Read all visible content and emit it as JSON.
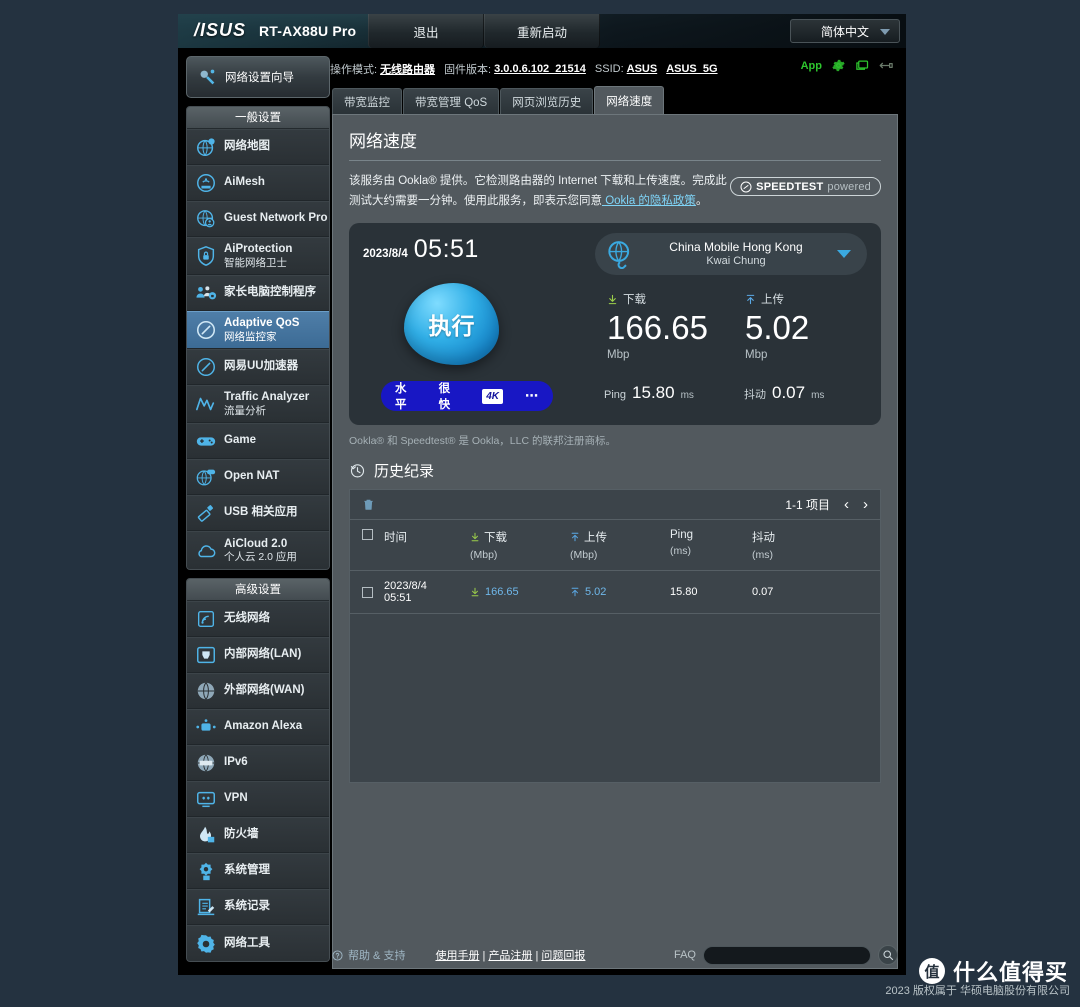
{
  "window": {
    "brand": "/ISUS",
    "model": "RT-AX88U Pro",
    "logout_label": "退出",
    "reboot_label": "重新启动",
    "language": "简体中文"
  },
  "info_bar": {
    "mode_label": "操作模式:",
    "mode_value": "无线路由器",
    "firmware_label": "固件版本:",
    "firmware_value": "3.0.0.6.102_21514",
    "ssid_label": "SSID:",
    "ssid_1": "ASUS",
    "ssid_2": "ASUS_5G",
    "app_label": "App"
  },
  "sidebar": {
    "wizard_label": "网络设置向导",
    "groups": [
      {
        "title": "一般设置",
        "items": [
          {
            "label": "网络地图",
            "sub": "",
            "icon": "network-map-icon",
            "active": false
          },
          {
            "label": "AiMesh",
            "sub": "",
            "icon": "aimesh-icon",
            "active": false
          },
          {
            "label": "Guest Network Pro",
            "sub": "",
            "icon": "guest-network-icon",
            "active": false
          },
          {
            "label": "AiProtection",
            "sub": "智能网络卫士",
            "icon": "shield-icon",
            "active": false
          },
          {
            "label": "家长电脑控制程序",
            "sub": "",
            "icon": "parental-control-icon",
            "active": false
          },
          {
            "label": "Adaptive QoS",
            "sub": "网络监控家",
            "icon": "qos-gauge-icon",
            "active": true
          },
          {
            "label": "网易UU加速器",
            "sub": "",
            "icon": "accelerator-icon",
            "active": false
          },
          {
            "label": "Traffic Analyzer",
            "sub": "流量分析",
            "icon": "traffic-analyzer-icon",
            "active": false
          },
          {
            "label": "Game",
            "sub": "",
            "icon": "gamepad-icon",
            "active": false
          },
          {
            "label": "Open NAT",
            "sub": "",
            "icon": "open-nat-icon",
            "active": false
          },
          {
            "label": "USB 相关应用",
            "sub": "",
            "icon": "usb-icon",
            "active": false
          },
          {
            "label": "AiCloud 2.0",
            "sub": "个人云 2.0 应用",
            "icon": "cloud-icon",
            "active": false
          }
        ]
      },
      {
        "title": "高级设置",
        "items": [
          {
            "label": "无线网络",
            "sub": "",
            "icon": "wifi-icon",
            "active": false
          },
          {
            "label": "内部网络(LAN)",
            "sub": "",
            "icon": "lan-port-icon",
            "active": false
          },
          {
            "label": "外部网络(WAN)",
            "sub": "",
            "icon": "globe-icon",
            "active": false
          },
          {
            "label": "Amazon Alexa",
            "sub": "",
            "icon": "alexa-icon",
            "active": false
          },
          {
            "label": "IPv6",
            "sub": "",
            "icon": "ipv6-icon",
            "active": false
          },
          {
            "label": "VPN",
            "sub": "",
            "icon": "vpn-icon",
            "active": false
          },
          {
            "label": "防火墙",
            "sub": "",
            "icon": "firewall-flame-icon",
            "active": false
          },
          {
            "label": "系统管理",
            "sub": "",
            "icon": "system-gear-icon",
            "active": false
          },
          {
            "label": "系统记录",
            "sub": "",
            "icon": "system-log-icon",
            "active": false
          },
          {
            "label": "网络工具",
            "sub": "",
            "icon": "network-tools-icon",
            "active": false
          }
        ]
      }
    ]
  },
  "tabs": [
    {
      "label": "带宽监控",
      "active": false
    },
    {
      "label": "带宽管理 QoS",
      "active": false
    },
    {
      "label": "网页浏览历史",
      "active": false
    },
    {
      "label": "网络速度",
      "active": true
    }
  ],
  "panel": {
    "title": "网络速度",
    "description_part1": "该服务由 Ookla® 提供。它检测路由器的 Internet 下载和上传速度。完成此测试大约需要一分钟。使用此服务，即表示您同意",
    "privacy_link": " Ookla 的隐私政策",
    "description_part2": "。",
    "badge_brand": "SPEEDTEST",
    "badge_powered": "powered",
    "trademark": "Ookla® 和 Speedtest® 是 Ookla，LLC 的联邦注册商标。"
  },
  "speed_test": {
    "date": "2023/8/4",
    "time": "05:51",
    "server_name": "China Mobile Hong Kong",
    "server_city": "Kwai Chung",
    "go_button": "执行",
    "download_label": "下载",
    "download_value": "166.65",
    "download_unit": "Mbp",
    "upload_label": "上传",
    "upload_value": "5.02",
    "upload_unit": "Mbp",
    "quality_label": "水平",
    "quality_value": "很快",
    "quality_badge": "4K",
    "quality_dots": "⋯",
    "ping_label": "Ping",
    "ping_value": "15.80",
    "ping_unit": "ms",
    "jitter_label": "抖动",
    "jitter_value": "0.07",
    "jitter_unit": "ms"
  },
  "history": {
    "title": "历史纪录",
    "pager_text": "1-1 项目",
    "prev_arrow": "‹",
    "next_arrow": "›",
    "columns": {
      "time": "时间",
      "download": "下载",
      "download_unit": "(Mbp)",
      "upload": "上传",
      "upload_unit": "(Mbp)",
      "ping": "Ping",
      "ping_unit": "(ms)",
      "jitter": "抖动",
      "jitter_unit": "(ms)"
    },
    "rows": [
      {
        "date": "2023/8/4",
        "time": "05:51",
        "download": "166.65",
        "upload": "5.02",
        "ping": "15.80",
        "jitter": "0.07"
      }
    ]
  },
  "footer": {
    "help_label": "帮助 & 支持",
    "link_manual": "使用手册",
    "link_register": "产品注册",
    "link_feedback": "问题回报",
    "separator": "|",
    "faq_label": "FAQ",
    "faq_placeholder": "",
    "copyright": "2023 版权属于 华硕电脑股份有限公司"
  },
  "watermark": {
    "badge": "值",
    "text": "什么值得买"
  },
  "colors": {
    "accent_blue": "#3aa9e0",
    "panel_gray": "#52595e",
    "active_menu": "#4f7ea8",
    "quality_blue": "#1817c4",
    "green": "#2ec62e"
  }
}
